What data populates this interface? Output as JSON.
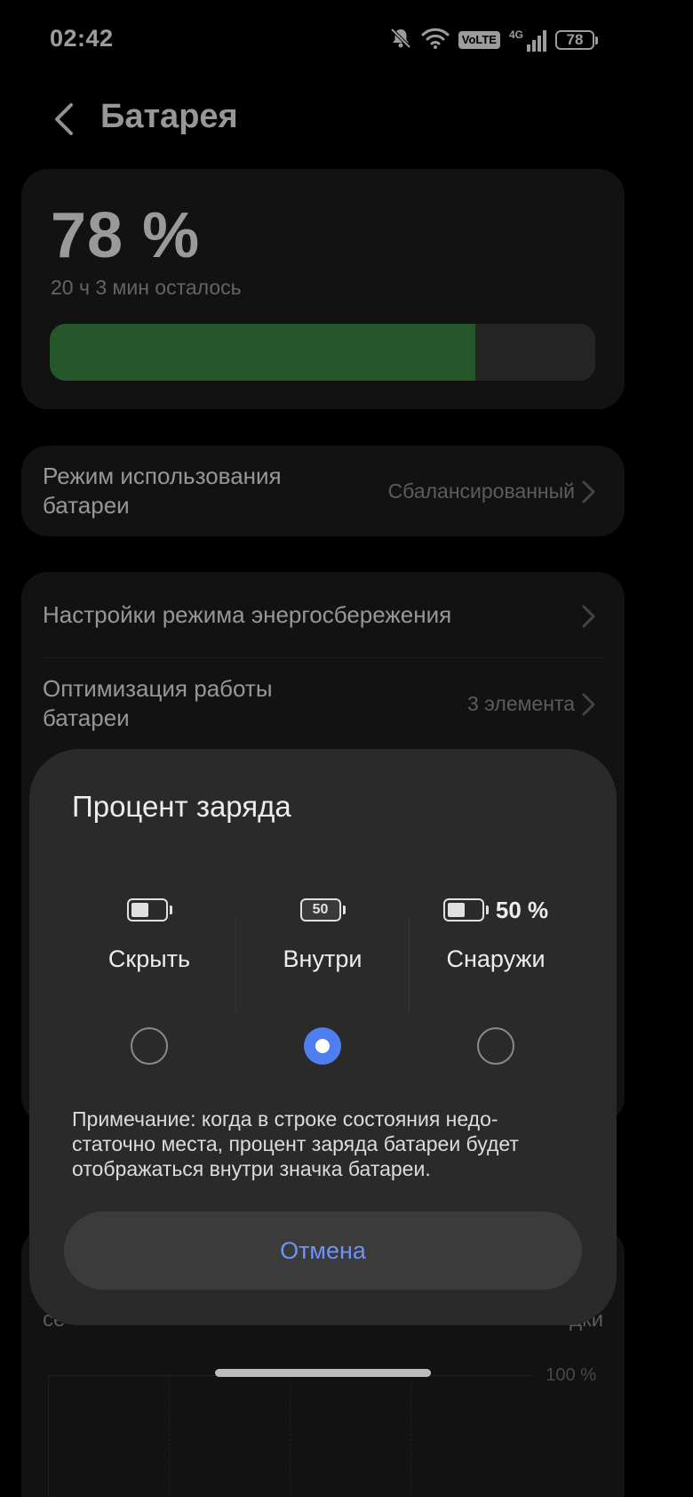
{
  "status_bar": {
    "time": "02:42",
    "volte_label": "VoLTE",
    "network_label": "4G",
    "battery_level": "78",
    "icons": [
      "bell-off-icon",
      "wifi-icon",
      "volte-badge",
      "cell-signal-icon",
      "battery-icon"
    ]
  },
  "header": {
    "back_icon": "chevron-left-icon",
    "title": "Батарея"
  },
  "battery": {
    "percent_text": "78 %",
    "remaining": "20 ч 3 мин осталось",
    "level_fraction": 0.78,
    "fill_color": "#3a8641"
  },
  "usage_mode": {
    "title_line1": "Режим использования",
    "title_line2": "батареи",
    "value": "Сбалансированный"
  },
  "settings": {
    "power_saving": "Настройки режима энергосбережения",
    "optimization_line1": "Оптимизация работы",
    "optimization_line2": "батареи",
    "optimization_value": "3 элемента"
  },
  "background_peek": {
    "left_text": "се",
    "right_text": "дки",
    "percent_label": "100 %"
  },
  "dialog": {
    "title": "Процент заряда",
    "options": [
      {
        "label": "Скрыть",
        "icon": "battery-hidden-icon",
        "selected": false
      },
      {
        "label": "Внутри",
        "icon": "battery-inside-icon",
        "icon_text": "50",
        "selected": true
      },
      {
        "label": "Снаружи",
        "icon": "battery-outside-icon",
        "icon_text": "50 %",
        "selected": false
      }
    ],
    "note": "Примечание: когда в строке состояния недо­статочно места, процент заряда батареи будет отображаться внутри значка батареи.",
    "cancel": "Отмена",
    "accent_color": "#4f7ef0"
  }
}
